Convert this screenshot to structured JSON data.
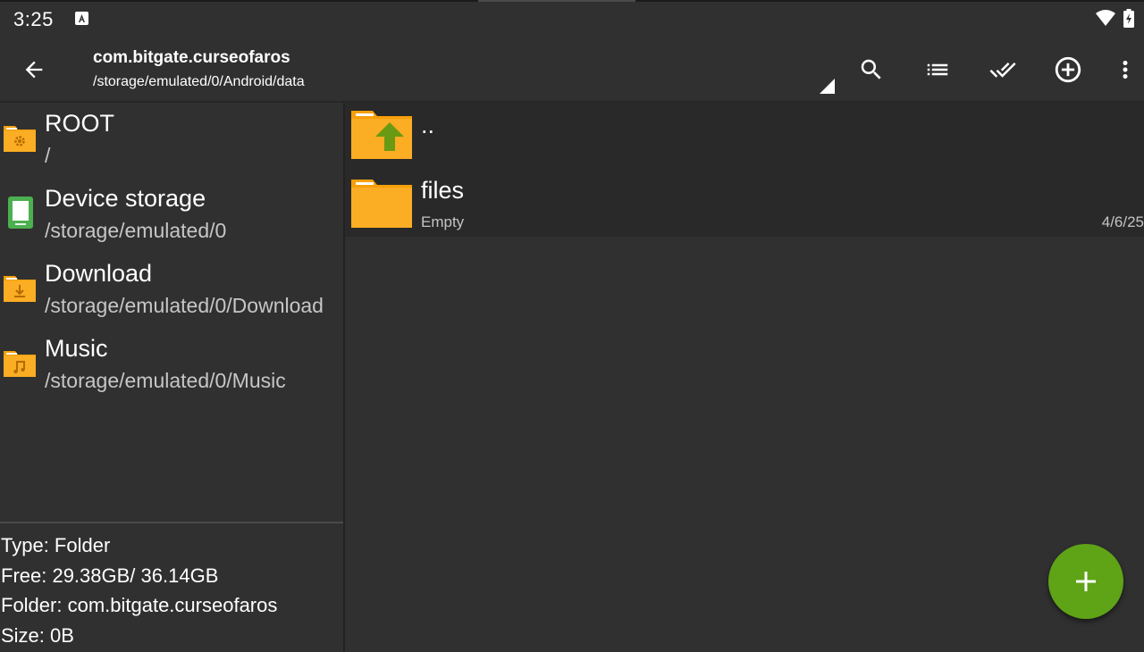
{
  "status_bar": {
    "time": "3:25",
    "notification_icon": "android-a-icon",
    "wifi_icon": "wifi-icon",
    "battery_icon": "battery-charging-icon"
  },
  "app_bar": {
    "back_icon": "arrow-back-icon",
    "title": "com.bitgate.curseofaros",
    "path": "/storage/emulated/0/Android/data",
    "actions": [
      "search-icon",
      "list-view-icon",
      "select-all-icon",
      "add-circle-icon",
      "more-vert-icon"
    ]
  },
  "bookmarks": [
    {
      "name": "ROOT",
      "path": "/",
      "icon": "folder-settings-icon"
    },
    {
      "name": "Device storage",
      "path": "/storage/emulated/0",
      "icon": "phone-storage-icon"
    },
    {
      "name": "Download",
      "path": "/storage/emulated/0/Download",
      "icon": "folder-download-icon"
    },
    {
      "name": "Music",
      "path": "/storage/emulated/0/Music",
      "icon": "folder-music-icon"
    }
  ],
  "info": {
    "type": "Type: Folder",
    "free": "Free: 29.38GB/ 36.14GB",
    "folder": "Folder: com.bitgate.curseofaros",
    "size": "Size: 0B"
  },
  "files": [
    {
      "name": "..",
      "icon": "folder-up-icon"
    },
    {
      "name": "files",
      "subtitle": "Empty",
      "date": "4/6/25",
      "icon": "folder-icon"
    }
  ],
  "fab": {
    "icon": "plus-icon"
  },
  "colors": {
    "background": "#303030",
    "row": "#292929",
    "folder": "#f9a825",
    "accent_green": "#5fa317"
  }
}
